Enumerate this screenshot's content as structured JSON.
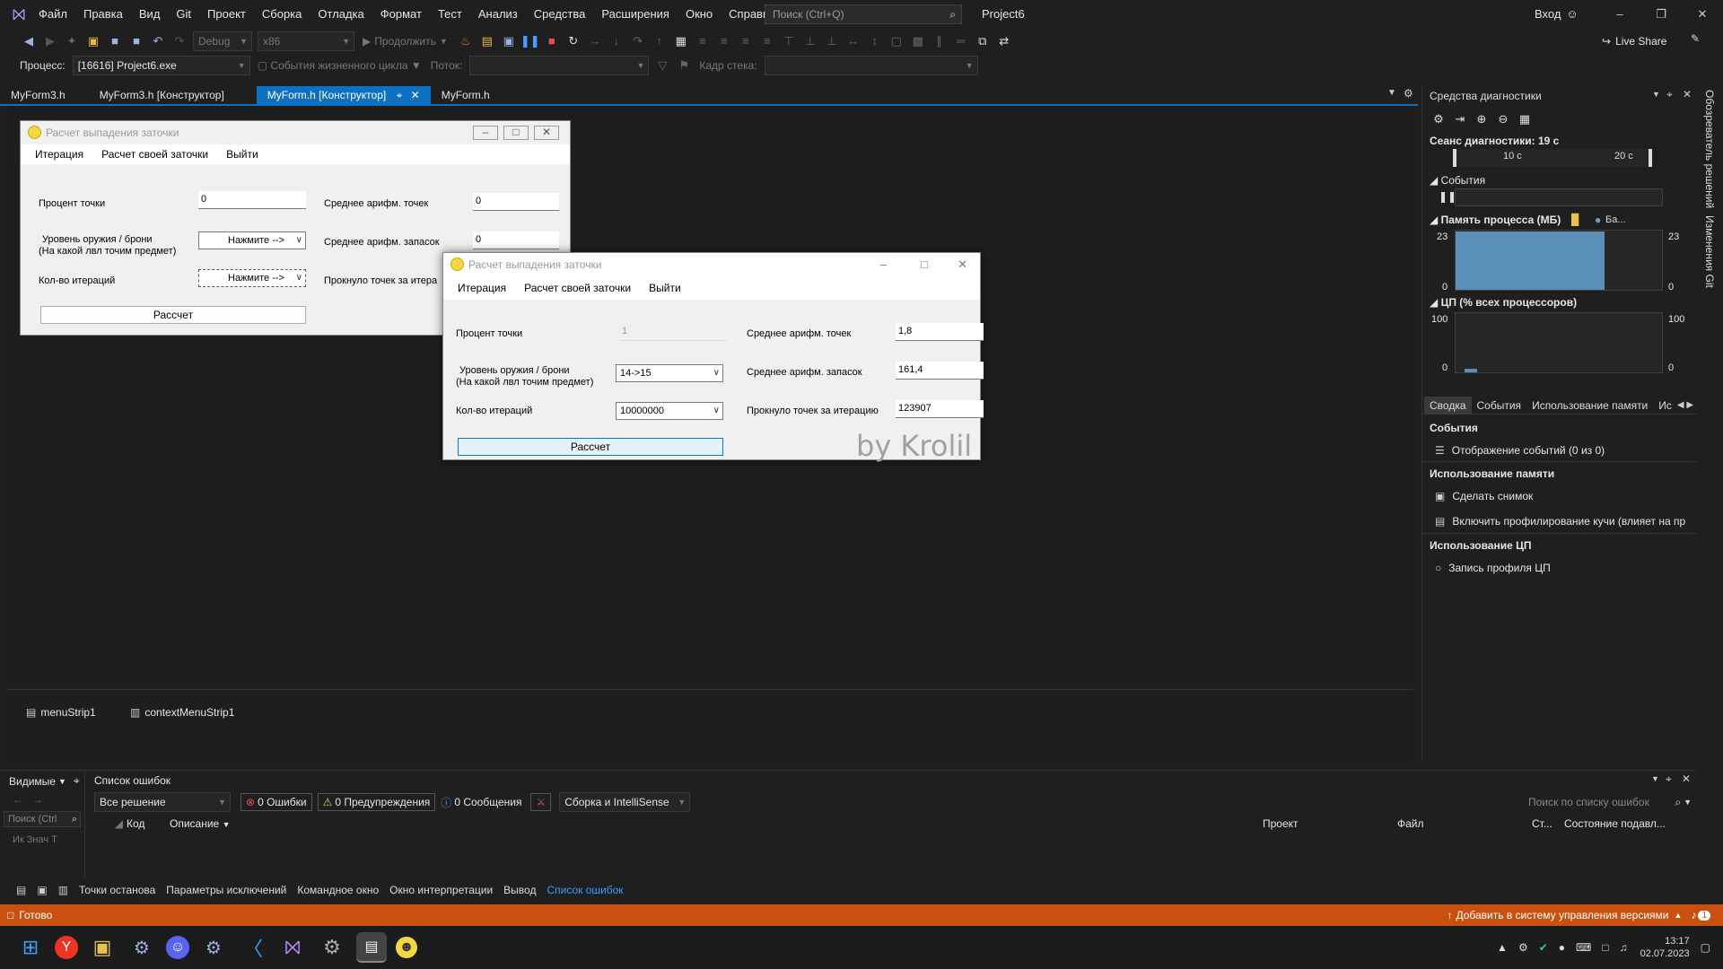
{
  "menubar": {
    "items": [
      "Файл",
      "Правка",
      "Вид",
      "Git",
      "Проект",
      "Сборка",
      "Отладка",
      "Формат",
      "Тест",
      "Анализ",
      "Средства",
      "Расширения",
      "Окно",
      "Справка"
    ],
    "search_placeholder": "Поиск (Ctrl+Q)",
    "project_name": "Project6",
    "signin": "Вход"
  },
  "toolbar": {
    "config": "Debug",
    "platform": "x86",
    "continue": "Продолжить",
    "live_share": "Live Share"
  },
  "toolbar2": {
    "process_label": "Процесс:",
    "process_value": "[16616] Project6.exe",
    "lifecycle": "События жизненного цикла",
    "thread_label": "Поток:",
    "stackframe_label": "Кадр стека:"
  },
  "tabs": [
    {
      "label": "MyForm3.h"
    },
    {
      "label": "MyForm3.h [Конструктор]"
    },
    {
      "label": "MyForm.h [Конструктор]"
    },
    {
      "label": "MyForm.h"
    }
  ],
  "designer_form": {
    "title": "Расчет выпадения заточки",
    "menu": [
      "Итерация",
      "Расчет своей заточки",
      "Выйти"
    ],
    "percent_label": "Процент точки",
    "percent_value": "0",
    "level_label_1": "Уровень оружия / брони",
    "level_label_2": "(На какой лвл точим предмет)",
    "level_value": "Нажмите -->",
    "iter_label": "Кол-во итераций",
    "iter_value": "Нажмите -->",
    "avg_points_label": "Среднее арифм. точек",
    "avg_points_value": "0",
    "avg_stock_label": "Среднее арифм. запасок",
    "avg_stock_value": "0",
    "pierced_label": "Прокнуло точек за итера",
    "calc_button": "Рассчет"
  },
  "running_form": {
    "title": "Расчет выпадения заточки",
    "menu": [
      "Итерация",
      "Расчет своей заточки",
      "Выйти"
    ],
    "percent_label": "Процент точки",
    "percent_value": "1",
    "level_label_1": "Уровень оружия / брони",
    "level_label_2": "(На какой лвл точим предмет)",
    "level_value": "14->15",
    "iter_label": "Кол-во итераций",
    "iter_value": "10000000",
    "avg_points_label": "Среднее арифм. точек",
    "avg_points_value": "1,8",
    "avg_stock_label": "Среднее арифм. запасок",
    "avg_stock_value": "161,4",
    "pierced_label": "Прокнуло точек за итерацию",
    "pierced_value": "123907",
    "calc_button": "Рассчет",
    "watermark": "by Krolil"
  },
  "components": [
    "menuStrip1",
    "contextMenuStrip1"
  ],
  "diagnostics": {
    "title": "Средства диагностики",
    "session": "Сеанс диагностики: 19 с",
    "tick_10": "10 с",
    "tick_20": "20 с",
    "events_label": "События",
    "memory_label": "Память процесса (МБ)",
    "memory_legend": "Ба...",
    "memory_max": "23",
    "memory_min": "0",
    "memory_level": 0.98,
    "cpu_label": "ЦП (% всех процессоров)",
    "cpu_max": "100",
    "cpu_min": "0",
    "tabs": [
      "Сводка",
      "События",
      "Использование памяти",
      "Ис"
    ],
    "section_events": "События",
    "events_display": "Отображение событий (0 из 0)",
    "section_memory": "Использование памяти",
    "snapshot": "Сделать снимок",
    "heap_profiling": "Включить профилирование кучи (влияет на пр",
    "section_cpu": "Использование ЦП",
    "cpu_profile": "Запись профиля ЦП"
  },
  "side_strip": {
    "solution_explorer": "Обозреватель решений",
    "git_changes": "Изменения Git"
  },
  "errors": {
    "visible_label": "Видимые",
    "title": "Список ошибок",
    "scope": "Все решение",
    "errors_btn": "0 Ошибки",
    "warnings_btn": "0 Предупреждения",
    "messages_btn": "0 Сообщения",
    "build_filter": "Сборка и IntelliSense",
    "search_placeholder": "Поиск по списку ошибок",
    "left_search": "Поиск (Ctrl",
    "left_cols": "Ик  Знач  Т",
    "columns": [
      "Код",
      "Описание",
      "Проект",
      "Файл",
      "Ст...",
      "Состояние подавл..."
    ]
  },
  "bottom_tabs": [
    "Точки останова",
    "Параметры исключений",
    "Командное окно",
    "Окно интерпретации",
    "Вывод",
    "Список ошибок"
  ],
  "status": {
    "ready": "Готово",
    "vcs": "Добавить в систему управления версиями",
    "notif_count": "1"
  },
  "taskbar": {
    "time": "13:17",
    "date": "02.07.2023",
    "icons": [
      "windows-start",
      "yandex-browser",
      "file-explorer",
      "steam",
      "discord",
      "steam-2",
      "vscode",
      "visual-studio",
      "settings",
      "app-window",
      "chicken-app"
    ]
  }
}
